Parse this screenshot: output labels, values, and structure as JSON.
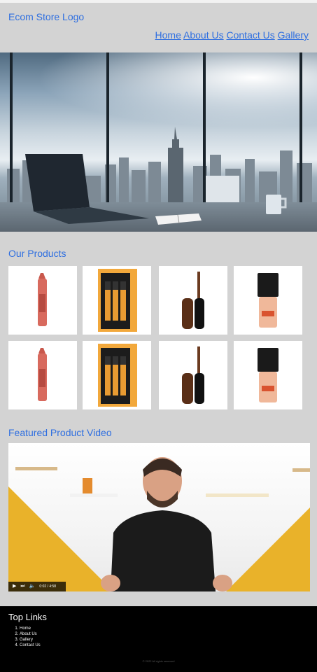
{
  "header": {
    "logo_text": "Ecom Store Logo",
    "nav": [
      "Home",
      "About Us",
      "Contact Us",
      "Gallery"
    ]
  },
  "products_section": {
    "title": "Our Products"
  },
  "products": [
    {
      "kind": "lipstick-crayon",
      "color": "#d86a5e"
    },
    {
      "kind": "brush-set",
      "color": "#f2a83b"
    },
    {
      "kind": "lip-gloss",
      "color": "#6b3b20"
    },
    {
      "kind": "foundation-bottle",
      "color": "#f0b89a"
    },
    {
      "kind": "lipstick-crayon",
      "color": "#d86a5e"
    },
    {
      "kind": "brush-set",
      "color": "#f2a83b"
    },
    {
      "kind": "lip-gloss",
      "color": "#6b3b20"
    },
    {
      "kind": "foundation-bottle",
      "color": "#f0b89a"
    }
  ],
  "video_section": {
    "title": "Featured Product Video"
  },
  "video": {
    "time": "0:02 / 4:58",
    "icons": [
      "play-icon",
      "next-icon",
      "volume-icon"
    ]
  },
  "footer": {
    "title": "Top Links",
    "links": [
      "Home",
      "About Us",
      "Gallery",
      "Contact Us"
    ],
    "copyright": "© 2022 All rights reserved"
  },
  "colors": {
    "accent": "#2f6fe0",
    "page_bg": "#d3d3d3",
    "footer_bg": "#000000"
  }
}
